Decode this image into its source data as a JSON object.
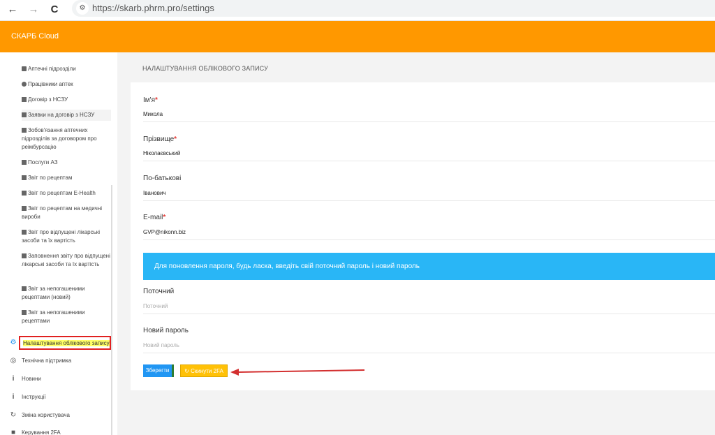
{
  "browser": {
    "url": "https://skarb.phrm.pro/settings",
    "back_icon": "←",
    "forward_icon": "→",
    "reload_icon": "C"
  },
  "header": {
    "title": "СКАРБ Cloud"
  },
  "sidebar": {
    "items": [
      {
        "label": "Аптечні підрозділи"
      },
      {
        "label": "Працівники аптек"
      },
      {
        "label": "Договір з НСЗУ"
      },
      {
        "label": "Заявки на договір з НСЗУ"
      },
      {
        "label": "Зобов'язання аптечних підрозділів за договором про реімбурсацію"
      },
      {
        "label": "Послуги АЗ"
      },
      {
        "label": "Звіт по рецептам"
      },
      {
        "label": "Звіт по рецептам E-Health"
      },
      {
        "label": "Звіт по рецептам на медичні вироби"
      },
      {
        "label": "Звіт про відпущені лікарські засоби та їх вартість"
      },
      {
        "label": "Заповнення звіту про відпущені лікарські засоби та їх вартість"
      },
      {
        "label": "Звіт за непогашеними рецептами (новий)"
      },
      {
        "label": "Звіт за непогашеними рецептами"
      }
    ],
    "top_items": [
      {
        "label": "Налаштування облікового запису"
      },
      {
        "label": "Технічна підтримка"
      },
      {
        "label": "Новини"
      },
      {
        "label": "Інструкції"
      },
      {
        "label": "Зміна користувача"
      },
      {
        "label": "Керування 2FA"
      }
    ]
  },
  "main": {
    "title": "НАЛАШТУВАННЯ ОБЛІКОВОГО ЗАПИСУ",
    "fields": {
      "first_name": {
        "label": "Ім'я",
        "value": "Микола"
      },
      "last_name": {
        "label": "Прізвище",
        "value": "Ніколаєвський"
      },
      "patronymic": {
        "label": "По-батькові",
        "value": "Іванович"
      },
      "email": {
        "label": "E-mail",
        "value": "GVP@nikonn.biz"
      },
      "current_password": {
        "label": "Поточний",
        "placeholder": "Поточний"
      },
      "new_password": {
        "label": "Новий пароль",
        "placeholder": "Новий пароль"
      }
    },
    "info_text": "Для поновлення пароля, будь ласка, введіть свій поточний пароль і новий пароль",
    "save_label": "Зберегти",
    "reset_2fa_label": "Скинути 2FA"
  },
  "colors": {
    "header": "#ff9800",
    "info": "#29b6f6",
    "save": "#2196f3",
    "reset": "#ffc107",
    "annotation": "#e02020"
  }
}
